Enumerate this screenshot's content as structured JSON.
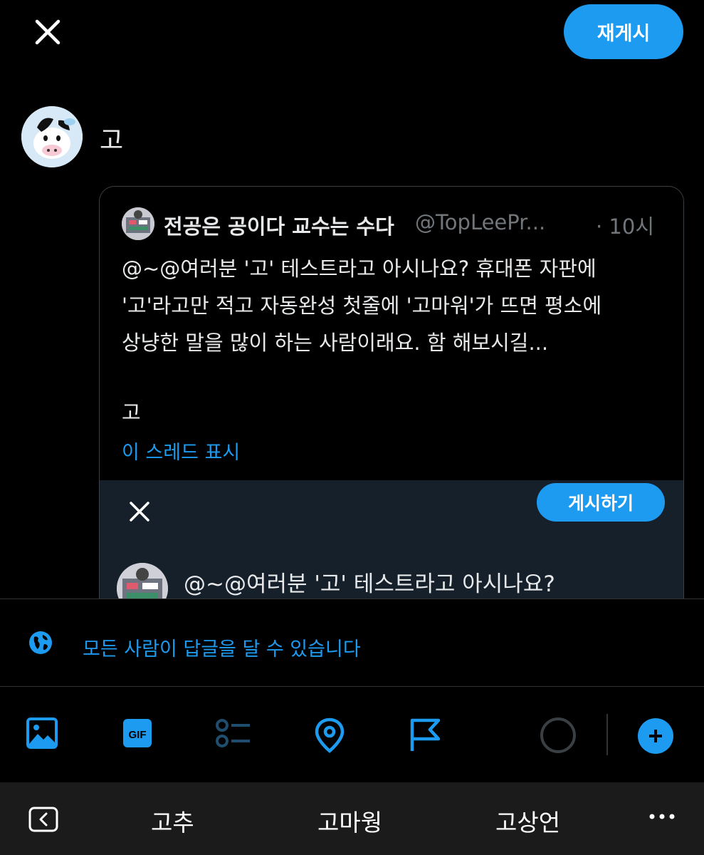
{
  "header": {
    "close_icon": "close-icon",
    "repost_label": "재게시"
  },
  "compose": {
    "text": "고"
  },
  "quote": {
    "name": "전공은 공이다 교수는 수다",
    "handle": "@TopLeePr...",
    "time": "· 10시",
    "lines": [
      "@~@여러분 '고' 테스트라고 아시나요? 휴대폰 자판에",
      "'고'라고만 적고 자동완성 첫줄에 '고마워'가 뜨면 평소에",
      "상냥한 말을 많이 하는 사람이래요. 함 해보시길...",
      "고"
    ],
    "thread_link": "이 스레드 표시",
    "inner": {
      "post_label": "게시하기",
      "text": "@~@여러분 '고' 테스트라고 아시나요?"
    }
  },
  "reply_setting": {
    "text": "모든 사람이 답글을 달 수 있습니다",
    "icon": "globe-icon"
  },
  "toolbar": {
    "icons": [
      "image-icon",
      "gif-icon",
      "poll-icon",
      "location-icon",
      "flag-icon",
      "progress-ring",
      "add-icon"
    ]
  },
  "keyboard": {
    "suggestions": [
      "고추",
      "고마웡",
      "고상언"
    ]
  },
  "colors": {
    "accent": "#1d9bf0",
    "background": "#000000",
    "inner_background": "#15202b",
    "secondary_text": "#71767b"
  }
}
